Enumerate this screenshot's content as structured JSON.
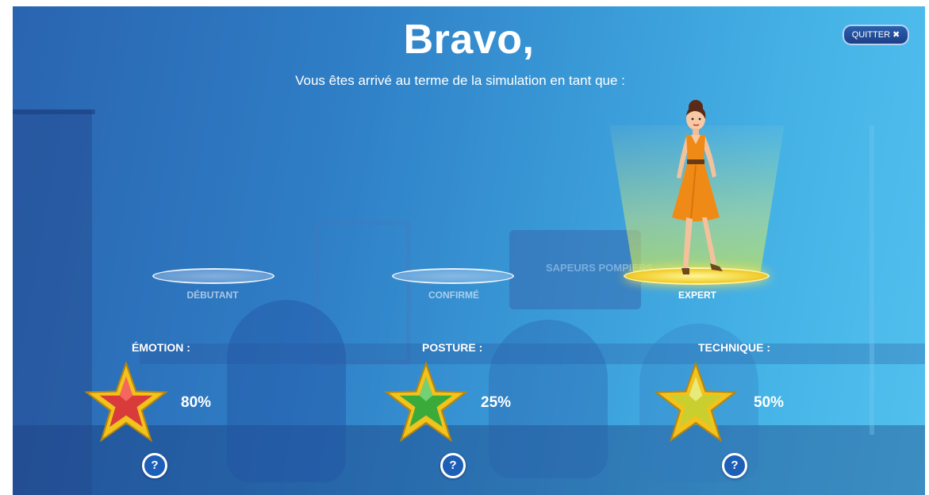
{
  "header": {
    "title": "Bravo,",
    "subtitle": "Vous êtes arrivé au terme de la simulation en tant que :",
    "quit_label": "QUITTER",
    "quit_icon": "close-icon"
  },
  "background": {
    "screen_text": "SAPEURS POMPIERS"
  },
  "levels": [
    {
      "label": "DÉBUTANT",
      "active": false
    },
    {
      "label": "CONFIRMÉ",
      "active": false
    },
    {
      "label": "EXPERT",
      "active": true
    }
  ],
  "scores": [
    {
      "label": "ÉMOTION :",
      "value": "80%",
      "star_color": "#d93a3a",
      "help": "?"
    },
    {
      "label": "POSTURE :",
      "value": "25%",
      "star_color": "#3aaa3a",
      "help": "?"
    },
    {
      "label": "TECHNIQUE :",
      "value": "50%",
      "star_color": "#c9cf2e",
      "help": "?"
    }
  ],
  "colors": {
    "star_gold": "#f2c21d",
    "active_platform": "#f3d33a",
    "dress": "#f08a16",
    "help_button": "#1d5fb6"
  }
}
